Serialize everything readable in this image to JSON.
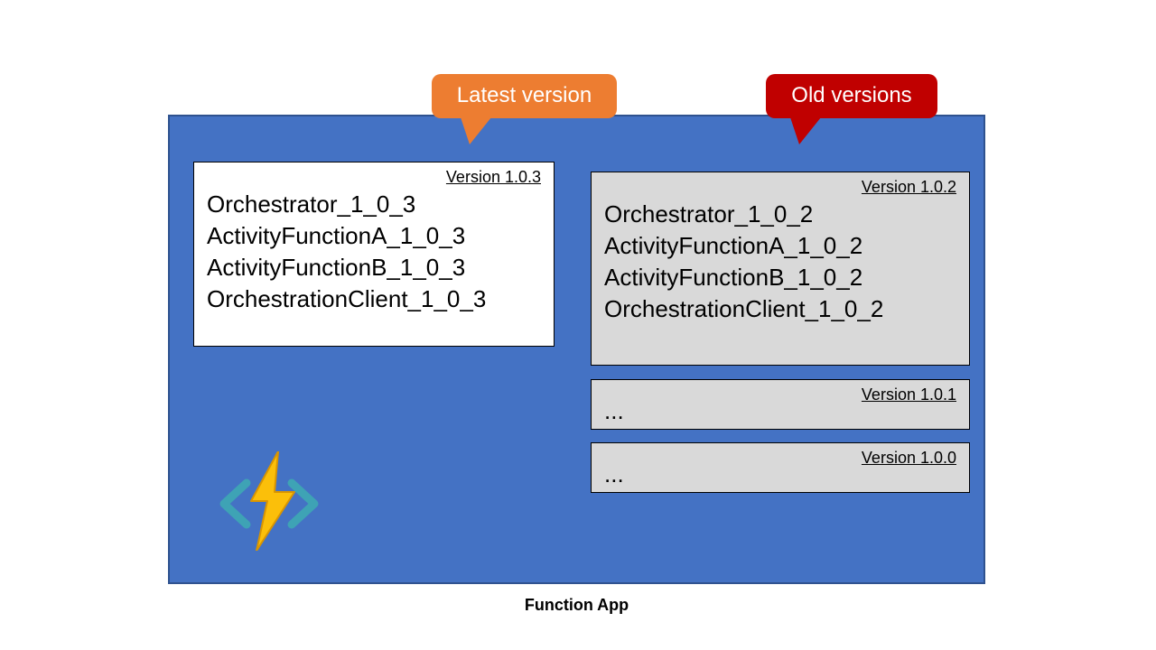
{
  "caption": "Function App",
  "callouts": {
    "latest": "Latest version",
    "old": "Old versions"
  },
  "versions": {
    "latest": {
      "label": "Version 1.0.3",
      "functions": [
        "Orchestrator_1_0_3",
        "ActivityFunctionA_1_0_3",
        "ActivityFunctionB_1_0_3",
        "OrchestrationClient_1_0_3"
      ]
    },
    "old_full": {
      "label": "Version 1.0.2",
      "functions": [
        "Orchestrator_1_0_2",
        "ActivityFunctionA_1_0_2",
        "ActivityFunctionB_1_0_2",
        "OrchestrationClient_1_0_2"
      ]
    },
    "old_collapsed": [
      {
        "label": "Version 1.0.1",
        "ellipsis": "..."
      },
      {
        "label": "Version 1.0.0",
        "ellipsis": "..."
      }
    ]
  }
}
